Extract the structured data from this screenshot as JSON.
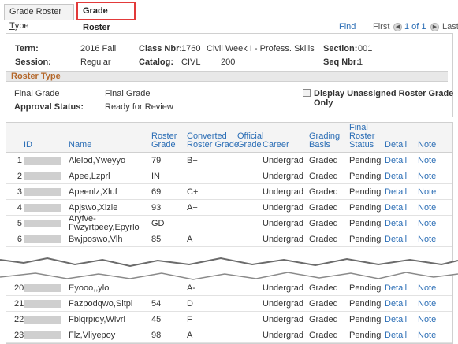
{
  "tabs": [
    {
      "label_pre": "Grade Roster ",
      "label_u": "T",
      "label_post": "ype"
    },
    {
      "label": "Grade Roster"
    }
  ],
  "nav": {
    "find": "Find",
    "first": "First",
    "range": "1 of 1",
    "last": "Last"
  },
  "header": {
    "term_label": "Term:",
    "term": "2016 Fall",
    "class_nbr_label": "Class Nbr:",
    "class_nbr": "1760",
    "class_title": "Civil Week I - Profess. Skills",
    "section_label": "Section:",
    "section": "001",
    "session_label": "Session:",
    "session": "Regular",
    "catalog_label": "Catalog:",
    "catalog_subject": "CIVL",
    "catalog_nbr": "200",
    "seq_label": "Seq Nbr:",
    "seq": "1"
  },
  "roster_type": {
    "title": "Roster Type",
    "type_label": "Final Grade",
    "type_value": "Final Grade",
    "approval_label": "Approval Status:",
    "approval_value": "Ready for Review",
    "checkbox_label": "Display Unassigned Roster Grade Only"
  },
  "columns": {
    "id": "ID",
    "name": "Name",
    "roster_grade": [
      "Roster",
      "Grade"
    ],
    "converted": [
      "Converted",
      "Roster Grade"
    ],
    "official": [
      "Official",
      "Grade"
    ],
    "career": "Career",
    "grading_basis": [
      "Grading",
      "Basis"
    ],
    "final_status": [
      "Final",
      "Roster",
      "Status"
    ],
    "detail": "Detail",
    "note": "Note"
  },
  "rows_top": [
    {
      "n": "1",
      "name": "Alelod,Yweyyo",
      "grade": "79",
      "conv": "B+",
      "career": "Undergrad",
      "basis": "Graded",
      "status": "Pending",
      "detail": "Detail",
      "note": "Note"
    },
    {
      "n": "2",
      "name": "Apee,Lzprl",
      "grade": "IN",
      "conv": "",
      "career": "Undergrad",
      "basis": "Graded",
      "status": "Pending",
      "detail": "Detail",
      "note": "Note"
    },
    {
      "n": "3",
      "name": "Apeenlz,Xluf",
      "grade": "69",
      "conv": "C+",
      "career": "Undergrad",
      "basis": "Graded",
      "status": "Pending",
      "detail": "Detail",
      "note": "Note"
    },
    {
      "n": "4",
      "name": "Apjswo,Xlzle",
      "grade": "93",
      "conv": "A+",
      "career": "Undergrad",
      "basis": "Graded",
      "status": "Pending",
      "detail": "Detail",
      "note": "Note"
    },
    {
      "n": "5",
      "name1": "Aryfve-",
      "name2": "Fwzyrtpeey,Epyrlo",
      "grade": "GD",
      "conv": "",
      "career": "Undergrad",
      "basis": "Graded",
      "status": "Pending",
      "detail": "Detail",
      "note": "Note"
    },
    {
      "n": "6",
      "name": "Bwjposwo,Vlh",
      "grade": "85",
      "conv": "A",
      "career": "Undergrad",
      "basis": "Graded",
      "status": "Pending",
      "detail": "Detail",
      "note": "Note"
    }
  ],
  "rows_bottom": [
    {
      "n": "20",
      "name": "Eyooo,,ylo",
      "grade": "",
      "conv": "A-",
      "career": "Undergrad",
      "basis": "Graded",
      "status": "Pending",
      "detail": "Detail",
      "note": "Note"
    },
    {
      "n": "21",
      "name": "Fazpodqwo,Sltpi",
      "grade": "54",
      "conv": "D",
      "career": "Undergrad",
      "basis": "Graded",
      "status": "Pending",
      "detail": "Detail",
      "note": "Note"
    },
    {
      "n": "22",
      "name": "Fblqrpidy,Wlvrl",
      "grade": "45",
      "conv": "F",
      "career": "Undergrad",
      "basis": "Graded",
      "status": "Pending",
      "detail": "Detail",
      "note": "Note"
    },
    {
      "n": "23",
      "name": "Flz,Vliyepoy",
      "grade": "98",
      "conv": "A+",
      "career": "Undergrad",
      "basis": "Graded",
      "status": "Pending",
      "detail": "Detail",
      "note": "Note"
    }
  ]
}
